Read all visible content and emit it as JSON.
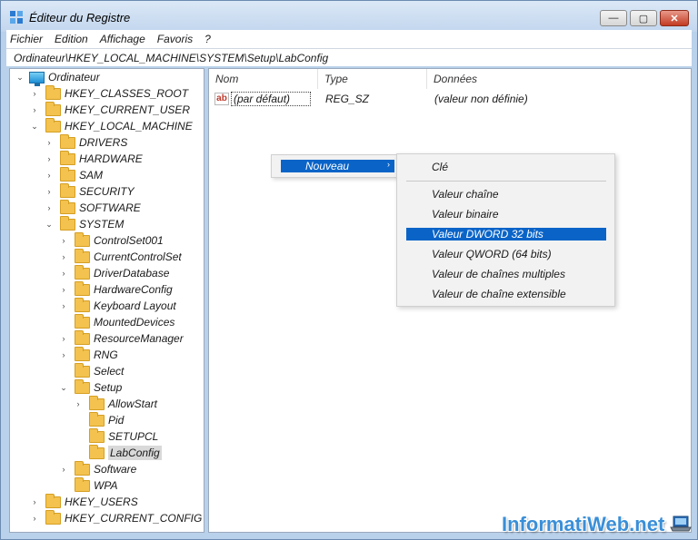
{
  "window": {
    "title": "Éditeur du Registre",
    "controls": {
      "minimize": "—",
      "maximize": "▢",
      "close": "✕"
    }
  },
  "menubar": [
    "Fichier",
    "Edition",
    "Affichage",
    "Favoris",
    "?"
  ],
  "address": "Ordinateur\\HKEY_LOCAL_MACHINE\\SYSTEM\\Setup\\LabConfig",
  "tree": {
    "root": "Ordinateur",
    "items": [
      {
        "label": "HKEY_CLASSES_ROOT",
        "expander": "›"
      },
      {
        "label": "HKEY_CURRENT_USER",
        "expander": "›"
      },
      {
        "label": "HKEY_LOCAL_MACHINE",
        "expander": "⌄"
      },
      {
        "label": "DRIVERS",
        "expander": "›"
      },
      {
        "label": "HARDWARE",
        "expander": "›"
      },
      {
        "label": "SAM",
        "expander": "›"
      },
      {
        "label": "SECURITY",
        "expander": "›"
      },
      {
        "label": "SOFTWARE",
        "expander": "›"
      },
      {
        "label": "SYSTEM",
        "expander": "⌄"
      },
      {
        "label": "ControlSet001",
        "expander": "›"
      },
      {
        "label": "CurrentControlSet",
        "expander": "›"
      },
      {
        "label": "DriverDatabase",
        "expander": "›"
      },
      {
        "label": "HardwareConfig",
        "expander": "›"
      },
      {
        "label": "Keyboard Layout",
        "expander": "›"
      },
      {
        "label": "MountedDevices",
        "expander": ""
      },
      {
        "label": "ResourceManager",
        "expander": "›"
      },
      {
        "label": "RNG",
        "expander": "›"
      },
      {
        "label": "Select",
        "expander": ""
      },
      {
        "label": "Setup",
        "expander": "⌄"
      },
      {
        "label": "AllowStart",
        "expander": "›"
      },
      {
        "label": "Pid",
        "expander": ""
      },
      {
        "label": "SETUPCL",
        "expander": ""
      },
      {
        "label": "LabConfig",
        "expander": ""
      },
      {
        "label": "Software",
        "expander": "›"
      },
      {
        "label": "WPA",
        "expander": ""
      },
      {
        "label": "HKEY_USERS",
        "expander": "›"
      },
      {
        "label": "HKEY_CURRENT_CONFIG",
        "expander": "›"
      }
    ]
  },
  "list": {
    "columns": [
      "Nom",
      "Type",
      "Données"
    ],
    "rows": [
      {
        "icon": "ab",
        "name": "(par défaut)",
        "type": "REG_SZ",
        "data": "(valeur non définie)"
      }
    ]
  },
  "context_menu": {
    "nouveau": "Nouveau",
    "submenu_arrow": "›",
    "submenu": [
      "Clé",
      "Valeur chaîne",
      "Valeur binaire",
      "Valeur DWORD 32 bits",
      "Valeur QWORD (64 bits)",
      "Valeur de chaînes multiples",
      "Valeur de chaîne extensible"
    ],
    "highlighted": "Valeur DWORD 32 bits"
  },
  "watermark": "InformatiWeb.net",
  "colors": {
    "accent": "#0a64c8",
    "folder": "#f3c24f",
    "window_frame": "#b9d1ea"
  }
}
